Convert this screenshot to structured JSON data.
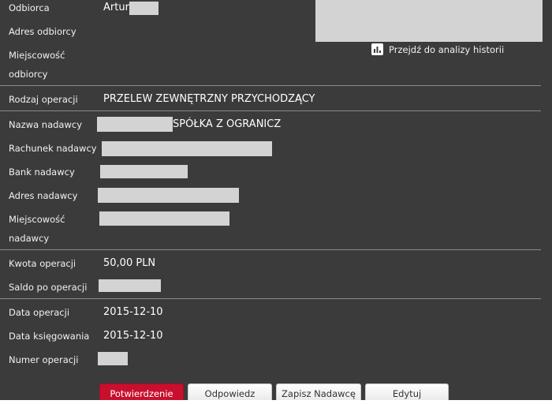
{
  "recipient": {
    "name_label": "Odbiorca",
    "name_value": "Artur",
    "address_label": "Adres odbiorcy",
    "city_label_line1": "Miejscowość",
    "city_label_line2": "odbiorcy"
  },
  "history_link": {
    "icon": "bar-chart-icon",
    "label": "Przejdź do analizy historii"
  },
  "operation_type": {
    "label": "Rodzaj operacji",
    "value": "PRZELEW ZEWNĘTRZNY PRZYCHODZĄCY"
  },
  "sender": {
    "name_label": "Nazwa nadawcy",
    "name_value_suffix": "SPÓŁKA Z OGRANICZ",
    "account_label": "Rachunek nadawcy",
    "bank_label": "Bank nadawcy",
    "address_label": "Adres nadawcy",
    "city_label_line1": "Miejscowość",
    "city_label_line2": "nadawcy"
  },
  "amounts": {
    "amount_label": "Kwota operacji",
    "amount_value": "50,00 PLN",
    "balance_label": "Saldo po operacji"
  },
  "dates": {
    "operation_date_label": "Data operacji",
    "operation_date_value": "2015-12-10",
    "booking_date_label": "Data księgowania",
    "booking_date_value": "2015-12-10",
    "operation_number_label": "Numer operacji"
  },
  "actions": {
    "confirm": "Potwierdzenie",
    "reply": "Odpowiedz",
    "save_sender": "Zapisz Nadawcę",
    "edit": "Edytuj"
  },
  "colors": {
    "background": "#3b3b3b",
    "primary_button": "#c8102e",
    "redaction": "#d3d3d3"
  }
}
